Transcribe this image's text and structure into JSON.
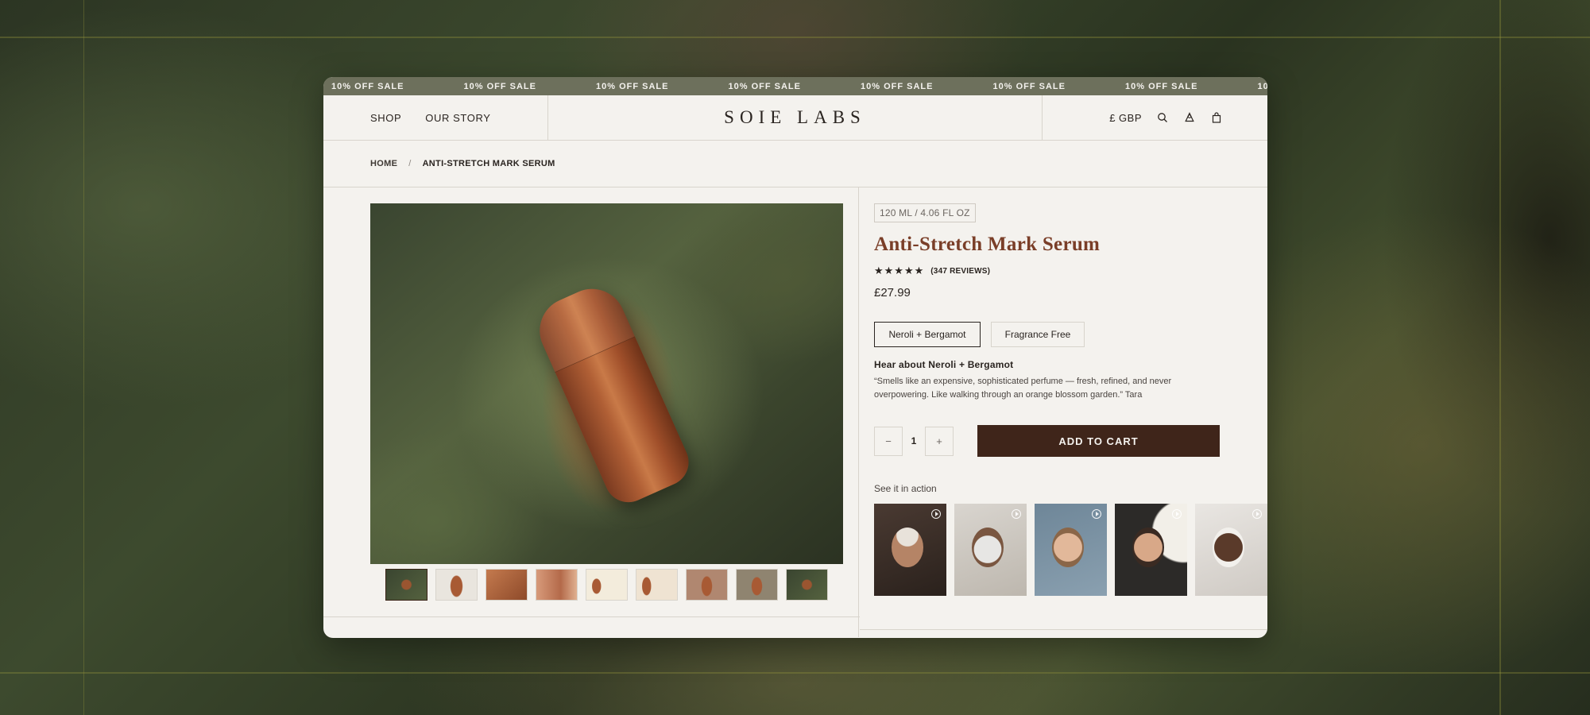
{
  "announcement": {
    "items": [
      "10% OFF SALE",
      "10% OFF SALE",
      "10% OFF SALE",
      "10% OFF SALE",
      "10% OFF SALE",
      "10% OFF SALE",
      "10% OFF SALE",
      "10"
    ]
  },
  "nav": {
    "shop": "SHOP",
    "our_story": "OUR STORY",
    "logo": "SOIE LABS",
    "currency": "£ GBP",
    "icons": [
      "search-icon",
      "account-icon",
      "bag-icon"
    ]
  },
  "breadcrumb": {
    "home": "HOME",
    "separator": "/",
    "current": "ANTI-STRETCH MARK SERUM"
  },
  "product": {
    "size": "120 ML / 4.06 FL OZ",
    "title": "Anti-Stretch Mark Serum",
    "stars": "★★★★★",
    "rating_value": 5,
    "reviews": "(347 REVIEWS)",
    "price": "£27.99",
    "variants": [
      "Neroli + Bergamot",
      "Fragrance Free"
    ],
    "selected_variant": "Neroli + Bergamot",
    "hear_title": "Hear about Neroli + Bergamot",
    "quote": "“Smells like an expensive, sophisticated perfume — fresh, refined, and never overpowering. Like walking through an orange blossom garden.” Tara",
    "quantity": "1",
    "qty_minus": "−",
    "qty_plus": "+",
    "add_to_cart": "ADD TO CART",
    "see_in_action": "See it in action"
  },
  "gallery": {
    "thumbnail_count": 9,
    "active_index": 0
  },
  "colors": {
    "marquee_bg": "#6d705c",
    "title": "#7a3e28",
    "cart_button": "#3f251a",
    "page_bg": "#f4f2ee"
  }
}
